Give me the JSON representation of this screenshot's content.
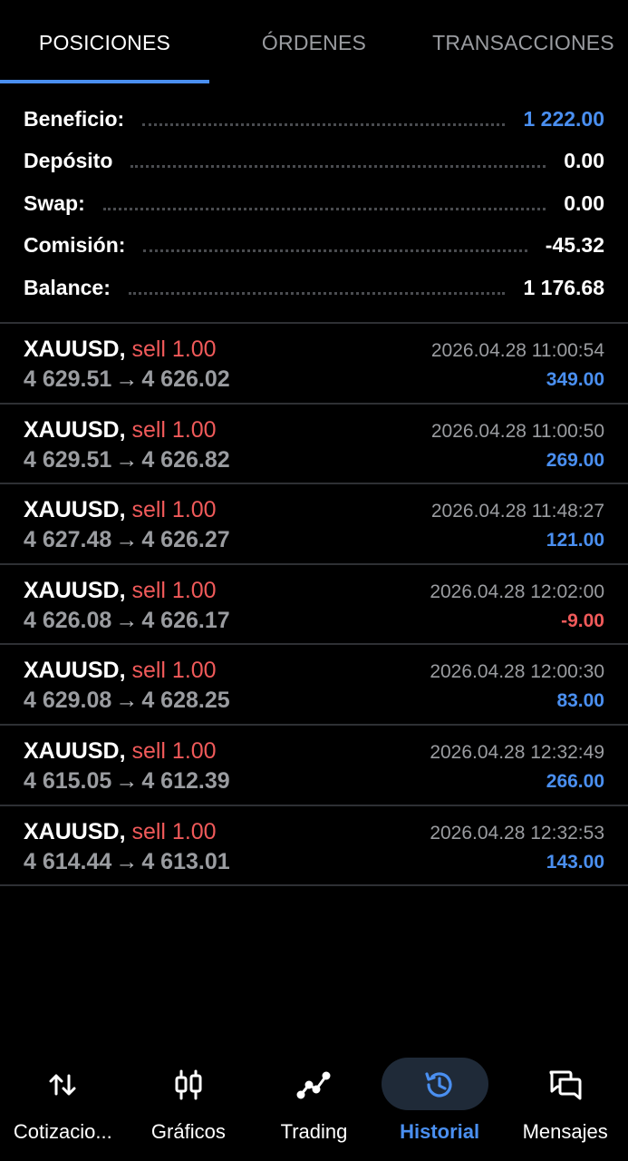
{
  "tabs": [
    {
      "label": "POSICIONES"
    },
    {
      "label": "ÓRDENES"
    },
    {
      "label": "TRANSACCIONES"
    }
  ],
  "summary": {
    "profit_label": "Beneficio:",
    "profit_value": "1 222.00",
    "deposit_label": "Depósito",
    "deposit_value": "0.00",
    "swap_label": "Swap:",
    "swap_value": "0.00",
    "commission_label": "Comisión:",
    "commission_value": "-45.32",
    "balance_label": "Balance:",
    "balance_value": "1 176.68"
  },
  "trades": [
    {
      "symbol": "XAUUSD,",
      "side": "sell 1.00",
      "open": "4 629.51",
      "close": "4 626.02",
      "time": "2026.04.28 11:00:54",
      "profit": "349.00"
    },
    {
      "symbol": "XAUUSD,",
      "side": "sell 1.00",
      "open": "4 629.51",
      "close": "4 626.82",
      "time": "2026.04.28 11:00:50",
      "profit": "269.00"
    },
    {
      "symbol": "XAUUSD,",
      "side": "sell 1.00",
      "open": "4 627.48",
      "close": "4 626.27",
      "time": "2026.04.28 11:48:27",
      "profit": "121.00"
    },
    {
      "symbol": "XAUUSD,",
      "side": "sell 1.00",
      "open": "4 626.08",
      "close": "4 626.17",
      "time": "2026.04.28 12:02:00",
      "profit": "-9.00"
    },
    {
      "symbol": "XAUUSD,",
      "side": "sell 1.00",
      "open": "4 629.08",
      "close": "4 628.25",
      "time": "2026.04.28 12:00:30",
      "profit": "83.00"
    },
    {
      "symbol": "XAUUSD,",
      "side": "sell 1.00",
      "open": "4 615.05",
      "close": "4 612.39",
      "time": "2026.04.28 12:32:49",
      "profit": "266.00"
    },
    {
      "symbol": "XAUUSD,",
      "side": "sell 1.00",
      "open": "4 614.44",
      "close": "4 613.01",
      "time": "2026.04.28 12:32:53",
      "profit": "143.00"
    }
  ],
  "arrow": "→",
  "nav": [
    {
      "label": "Cotizacio...",
      "icon": "quotes-arrows-icon"
    },
    {
      "label": "Gráficos",
      "icon": "candlestick-chart-icon"
    },
    {
      "label": "Trading",
      "icon": "trading-line-icon"
    },
    {
      "label": "Historial",
      "icon": "history-icon"
    },
    {
      "label": "Mensajes",
      "icon": "messages-icon"
    }
  ],
  "colors": {
    "accent": "#4a8ff0",
    "sell": "#f05a5a",
    "muted": "#9a9ca0",
    "background": "#000000"
  }
}
